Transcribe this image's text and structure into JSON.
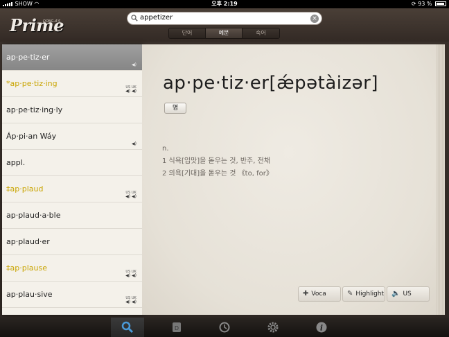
{
  "status": {
    "carrier": "SHOW",
    "time": "오후 2:19",
    "battery": "93 %"
  },
  "app": {
    "logo": "Prime",
    "logo_sub": "DONG-A'S"
  },
  "search": {
    "value": "appetizer"
  },
  "segments": [
    {
      "label": "단어",
      "active": false
    },
    {
      "label": "예문",
      "active": true
    },
    {
      "label": "숙어",
      "active": false
    }
  ],
  "word_list": [
    {
      "word": "ap·pe·tiz·er",
      "audio": "us",
      "selected": true,
      "highlight": false
    },
    {
      "word": "*ap·pe·tiz·ing",
      "audio": "usuk",
      "selected": false,
      "highlight": true
    },
    {
      "word": "ap·pe·tiz·ing·ly",
      "audio": "none",
      "selected": false,
      "highlight": false
    },
    {
      "word": "Áp·pi·an Wáy",
      "audio": "us",
      "selected": false,
      "highlight": false
    },
    {
      "word": "appl.",
      "audio": "none",
      "selected": false,
      "highlight": false
    },
    {
      "word": "‡ap·plaud",
      "audio": "usuk",
      "selected": false,
      "highlight": true
    },
    {
      "word": "ap·plaud·a·ble",
      "audio": "none",
      "selected": false,
      "highlight": false
    },
    {
      "word": "ap·plaud·er",
      "audio": "none",
      "selected": false,
      "highlight": false
    },
    {
      "word": "‡ap·plause",
      "audio": "usuk",
      "selected": false,
      "highlight": true
    },
    {
      "word": "ap·plau·sive",
      "audio": "usuk",
      "selected": false,
      "highlight": false
    }
  ],
  "entry": {
    "headword": "ap·pe·tiz·er[ǽpətàizər]",
    "pos_button": "명",
    "pos": "n.",
    "senses": [
      "1 식욕[입맛]을 돋우는 것, 반주, 전채",
      "2 의욕[기대]을 돋우는 것 《to, for》"
    ]
  },
  "toolbar": {
    "voca": "Voca",
    "highlight": "Highlight",
    "us": "US"
  },
  "tabs": [
    {
      "name": "search-icon",
      "active": true
    },
    {
      "name": "dictionary-icon",
      "active": false
    },
    {
      "name": "history-icon",
      "active": false
    },
    {
      "name": "settings-icon",
      "active": false
    },
    {
      "name": "info-icon",
      "active": false
    }
  ],
  "colors": {
    "highlight_word": "#c9a400",
    "page": "#ebe6dd",
    "selected_row": "#929292"
  }
}
